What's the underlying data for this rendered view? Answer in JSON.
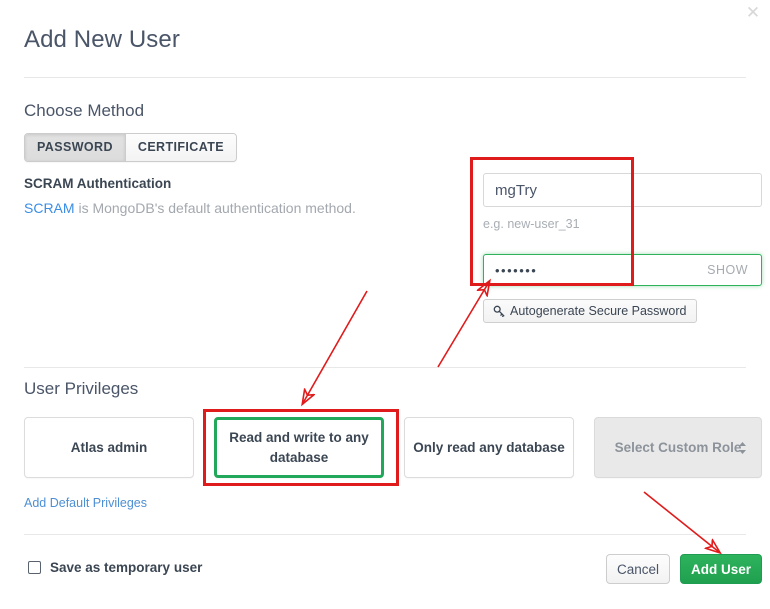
{
  "modal": {
    "title": "Add New User",
    "close_icon": "close-icon"
  },
  "method_section": {
    "heading": "Choose Method",
    "tabs": [
      {
        "label": "PASSWORD",
        "active": true
      },
      {
        "label": "CERTIFICATE",
        "active": false
      }
    ],
    "auth_title": "SCRAM Authentication",
    "auth_link": "SCRAM",
    "auth_desc": " is MongoDB's default authentication method."
  },
  "credentials": {
    "username_value": "mgTry",
    "username_placeholder": "",
    "username_hint": "e.g. new-user_31",
    "password_value": "•••••••",
    "password_placeholder": "",
    "show_label": "SHOW",
    "autogenerate_label": "Autogenerate Secure Password",
    "autogenerate_icon": "key-icon"
  },
  "privileges": {
    "heading": "User Privileges",
    "options": [
      {
        "label": "Atlas admin",
        "selected": false
      },
      {
        "label": "Read and write to any database",
        "selected": true
      },
      {
        "label": "Only read any database",
        "selected": false
      }
    ],
    "custom_role": {
      "label": "Select Custom Role",
      "icon": "chevron-updown-icon",
      "disabled": true
    },
    "add_default_link": "Add Default Privileges"
  },
  "footer": {
    "temporary_user_label": "Save as temporary user",
    "temporary_user_checked": false,
    "cancel_label": "Cancel",
    "submit_label": "Add User"
  },
  "annotations": {
    "colors": {
      "callout_red": "#e01b1b",
      "selected_green": "#22a85a",
      "primary_green": "#2eb35d",
      "link_blue": "#3a8ee6"
    },
    "boxes": [
      {
        "name": "credentials-highlight"
      },
      {
        "name": "privilege-highlight"
      }
    ],
    "arrows": [
      {
        "name": "arrow-to-password-field"
      },
      {
        "name": "arrow-to-privilege-box"
      },
      {
        "name": "arrow-to-add-user-button"
      }
    ]
  }
}
